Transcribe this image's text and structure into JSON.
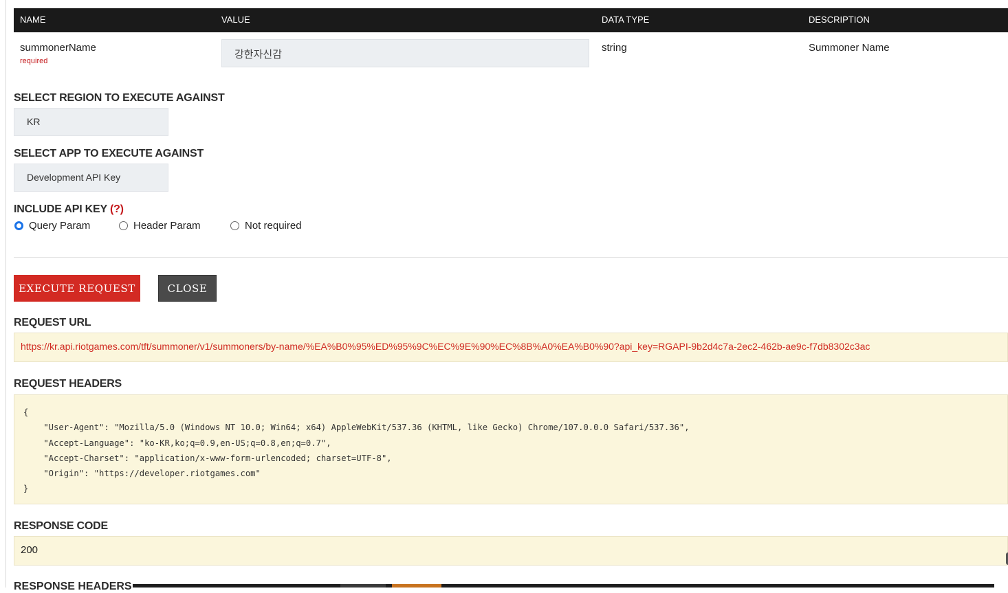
{
  "params_table": {
    "headers": [
      "NAME",
      "VALUE",
      "DATA TYPE",
      "DESCRIPTION"
    ],
    "row": {
      "name": "summonerName",
      "required_label": "required",
      "value": "강한자신감",
      "data_type": "string",
      "description": "Summoner Name"
    }
  },
  "region": {
    "label": "SELECT REGION TO EXECUTE AGAINST",
    "selected": "KR"
  },
  "app": {
    "label": "SELECT APP TO EXECUTE AGAINST",
    "selected": "Development API Key"
  },
  "api_key": {
    "label": "INCLUDE API KEY",
    "help": "(?)",
    "options": [
      {
        "label": "Query Param",
        "checked": true
      },
      {
        "label": "Header Param",
        "checked": false
      },
      {
        "label": "Not required",
        "checked": false
      }
    ]
  },
  "buttons": {
    "execute": "EXECUTE REQUEST",
    "close": "CLOSE"
  },
  "request_url": {
    "label": "REQUEST URL",
    "value": "https://kr.api.riotgames.com/tft/summoner/v1/summoners/by-name/%EA%B0%95%ED%95%9C%EC%9E%90%EC%8B%A0%EA%B0%90?api_key=RGAPI-9b2d4c7a-2ec2-462b-ae9c-f7db8302c3ac"
  },
  "request_headers": {
    "label": "REQUEST HEADERS",
    "value": "{\n    \"User-Agent\": \"Mozilla/5.0 (Windows NT 10.0; Win64; x64) AppleWebKit/537.36 (KHTML, like Gecko) Chrome/107.0.0.0 Safari/537.36\",\n    \"Accept-Language\": \"ko-KR,ko;q=0.9,en-US;q=0.8,en;q=0.7\",\n    \"Accept-Charset\": \"application/x-www-form-urlencoded; charset=UTF-8\",\n    \"Origin\": \"https://developer.riotgames.com\"\n}"
  },
  "response_code": {
    "label": "RESPONSE CODE",
    "value": "200"
  },
  "response_headers": {
    "label": "RESPONSE HEADERS"
  },
  "colors": {
    "accent_red": "#d32a23",
    "box_yellow": "#fbf6dc",
    "radio_blue": "#1a73e8"
  }
}
